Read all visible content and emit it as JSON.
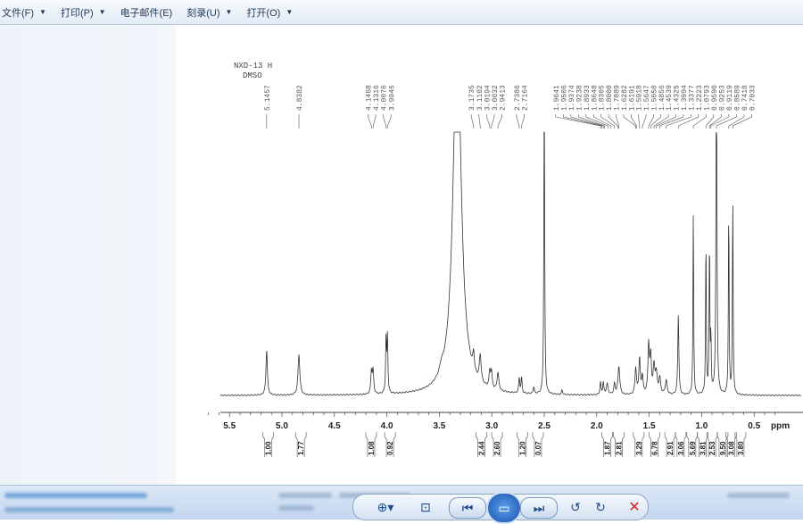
{
  "menu": [
    {
      "label": "文件(F)",
      "has_arrow": true
    },
    {
      "label": "打印(P)",
      "has_arrow": true
    },
    {
      "label": "电子邮件(E)",
      "has_arrow": false
    },
    {
      "label": "刻录(U)",
      "has_arrow": true
    },
    {
      "label": "打开(O)",
      "has_arrow": true
    }
  ],
  "controls": {
    "zoom_icon": "zoom-icon",
    "fit_icon": "actual-size-icon",
    "prev_icon": "previous-icon",
    "slideshow_icon": "slideshow-icon",
    "next_icon": "next-icon",
    "rotate_ccw_icon": "rotate-ccw-icon",
    "rotate_cw_icon": "rotate-cw-icon",
    "delete_icon": "delete-icon",
    "delete_color": "#d42020"
  },
  "chart_data": {
    "type": "line",
    "title_line1": "NXD-13 H",
    "title_line2": "DMSO",
    "xlabel": "ppm",
    "xlim": [
      5.7,
      0.0
    ],
    "xticks": [
      "5.5",
      "5.0",
      "4.5",
      "4.0",
      "3.5",
      "3.0",
      "2.5",
      "2.0",
      "1.5",
      "1.0",
      "0.5"
    ],
    "xtick_values": [
      5.5,
      5.0,
      4.5,
      4.0,
      3.5,
      3.0,
      2.5,
      2.0,
      1.5,
      1.0,
      0.5
    ],
    "peak_labels": [
      "5.1457",
      "4.8382",
      "4.1468",
      "4.1316",
      "4.0076",
      "3.9945",
      "3.1735",
      "3.1102",
      "3.0194",
      "3.0032",
      "2.9413",
      "2.7386",
      "2.7164",
      "1.9641",
      "1.9506",
      "1.9374",
      "1.9238",
      "1.8933",
      "1.8648",
      "1.8305",
      "1.8000",
      "1.7889",
      "1.6282",
      "1.6191",
      "1.5918",
      "1.5647",
      "1.5050",
      "1.4856",
      "1.4539",
      "1.4325",
      "1.3994",
      "1.3377",
      "1.2223",
      "1.0793",
      "0.9590",
      "0.9253",
      "0.9119",
      "0.8589",
      "0.7418",
      "0.7033"
    ],
    "peaks": [
      {
        "ppm": 5.1457,
        "h": 51,
        "w": 0.008
      },
      {
        "ppm": 4.8382,
        "h": 46,
        "w": 0.01
      },
      {
        "ppm": 4.1468,
        "h": 26,
        "w": 0.007
      },
      {
        "ppm": 4.1316,
        "h": 26,
        "w": 0.007
      },
      {
        "ppm": 4.0076,
        "h": 62,
        "w": 0.005
      },
      {
        "ppm": 3.9945,
        "h": 62,
        "w": 0.005
      },
      {
        "ppm": 3.33,
        "h": 420,
        "w": 0.045
      },
      {
        "ppm": 3.48,
        "h": 8,
        "w": 0.02
      },
      {
        "ppm": 3.1735,
        "h": 20,
        "w": 0.008
      },
      {
        "ppm": 3.1102,
        "h": 30,
        "w": 0.01
      },
      {
        "ppm": 3.0194,
        "h": 18,
        "w": 0.008
      },
      {
        "ppm": 3.0032,
        "h": 18,
        "w": 0.008
      },
      {
        "ppm": 2.9413,
        "h": 20,
        "w": 0.01
      },
      {
        "ppm": 2.7386,
        "h": 17,
        "w": 0.006
      },
      {
        "ppm": 2.7164,
        "h": 17,
        "w": 0.006
      },
      {
        "ppm": 2.6,
        "h": 8,
        "w": 0.006
      },
      {
        "ppm": 2.5,
        "h": 420,
        "w": 0.004
      },
      {
        "ppm": 2.33,
        "h": 5,
        "w": 0.006
      },
      {
        "ppm": 1.9641,
        "h": 14,
        "w": 0.006
      },
      {
        "ppm": 1.9374,
        "h": 14,
        "w": 0.006
      },
      {
        "ppm": 1.9,
        "h": 12,
        "w": 0.01
      },
      {
        "ppm": 1.8305,
        "h": 12,
        "w": 0.008
      },
      {
        "ppm": 1.7889,
        "h": 32,
        "w": 0.01
      },
      {
        "ppm": 1.6282,
        "h": 30,
        "w": 0.008
      },
      {
        "ppm": 1.5918,
        "h": 40,
        "w": 0.008
      },
      {
        "ppm": 1.5647,
        "h": 20,
        "w": 0.008
      },
      {
        "ppm": 1.505,
        "h": 55,
        "w": 0.008
      },
      {
        "ppm": 1.4856,
        "h": 40,
        "w": 0.008
      },
      {
        "ppm": 1.4539,
        "h": 30,
        "w": 0.01
      },
      {
        "ppm": 1.4325,
        "h": 22,
        "w": 0.01
      },
      {
        "ppm": 1.3994,
        "h": 18,
        "w": 0.01
      },
      {
        "ppm": 1.3377,
        "h": 16,
        "w": 0.01
      },
      {
        "ppm": 1.2223,
        "h": 90,
        "w": 0.006
      },
      {
        "ppm": 1.0793,
        "h": 205,
        "w": 0.004
      },
      {
        "ppm": 0.959,
        "h": 175,
        "w": 0.004
      },
      {
        "ppm": 0.9253,
        "h": 170,
        "w": 0.004
      },
      {
        "ppm": 0.9119,
        "h": 60,
        "w": 0.004
      },
      {
        "ppm": 0.8589,
        "h": 420,
        "w": 0.005
      },
      {
        "ppm": 0.7418,
        "h": 210,
        "w": 0.004
      },
      {
        "ppm": 0.7033,
        "h": 220,
        "w": 0.004
      }
    ],
    "integrals": [
      {
        "ppm": 5.13,
        "label": "1.00"
      },
      {
        "ppm": 4.82,
        "label": "1.77"
      },
      {
        "ppm": 4.15,
        "label": "1.08"
      },
      {
        "ppm": 3.97,
        "label": "0.92"
      },
      {
        "ppm": 3.1,
        "label": "2.44"
      },
      {
        "ppm": 2.95,
        "label": "2.60"
      },
      {
        "ppm": 2.71,
        "label": "1.20"
      },
      {
        "ppm": 2.56,
        "label": "0.07"
      },
      {
        "ppm": 1.9,
        "label": "1.87"
      },
      {
        "ppm": 1.79,
        "label": "2.81"
      },
      {
        "ppm": 1.6,
        "label": "3.29"
      },
      {
        "ppm": 1.45,
        "label": "6.78"
      },
      {
        "ppm": 1.3,
        "label": "2.91"
      },
      {
        "ppm": 1.2,
        "label": "3.06"
      },
      {
        "ppm": 1.09,
        "label": "5.69"
      },
      {
        "ppm": 0.99,
        "label": "3.81"
      },
      {
        "ppm": 0.9,
        "label": "2.53"
      },
      {
        "ppm": 0.8,
        "label": "9.50"
      },
      {
        "ppm": 0.72,
        "label": "3.08"
      },
      {
        "ppm": 0.63,
        "label": "3.80"
      }
    ]
  }
}
